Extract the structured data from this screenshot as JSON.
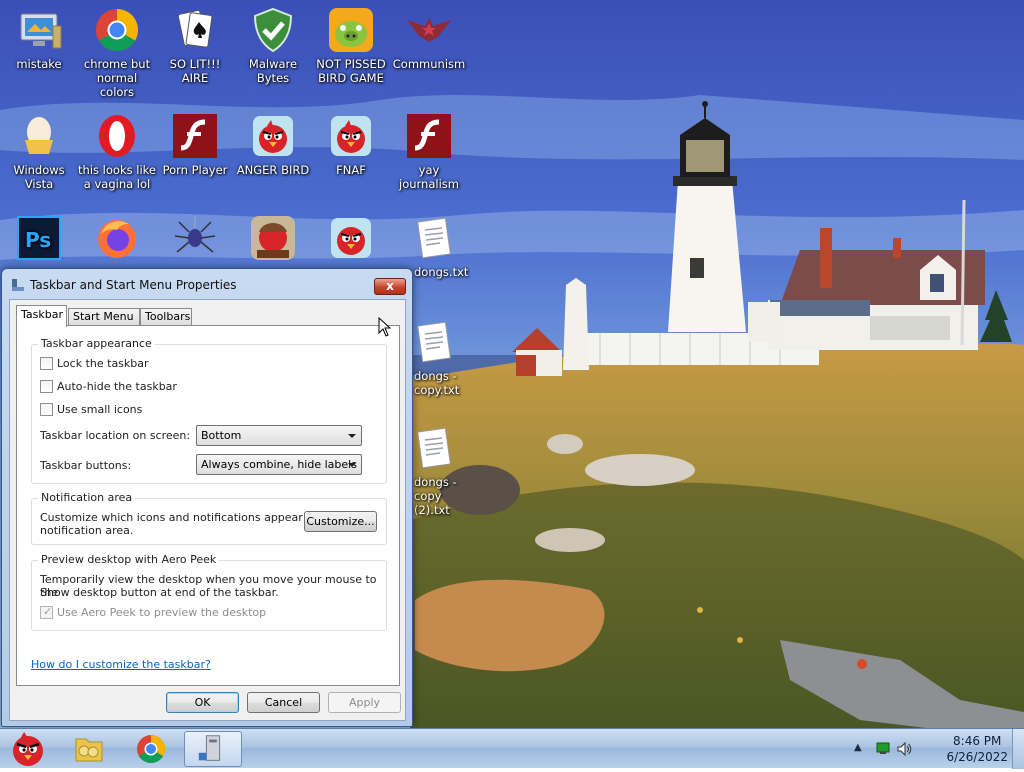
{
  "desktop": {
    "icons": [
      {
        "label": "mistake",
        "icon": "computer-icon"
      },
      {
        "label": "chrome but normal colors",
        "icon": "chrome-icon"
      },
      {
        "label": "SO LIT!!! AIRE",
        "icon": "solitaire-icon"
      },
      {
        "label": "Malware Bytes",
        "icon": "shield-icon"
      },
      {
        "label": "NOT PISSED BIRD GAME",
        "icon": "bad-piggies-icon"
      },
      {
        "label": "Communism",
        "icon": "star-icon"
      },
      {
        "label": "Windows Vista",
        "icon": "egg-icon"
      },
      {
        "label": "this looks like a vagina lol",
        "icon": "opera-icon"
      },
      {
        "label": "Porn Player",
        "icon": "flash-icon"
      },
      {
        "label": "ANGER BIRD",
        "icon": "angry-bird-icon"
      },
      {
        "label": "FNAF",
        "icon": "angry-bird-icon"
      },
      {
        "label": "yay journalism",
        "icon": "flash-icon"
      },
      {
        "label": "",
        "icon": "photoshop-icon"
      },
      {
        "label": "",
        "icon": "firefox-icon"
      },
      {
        "label": "",
        "icon": "spider-solitaire-icon"
      },
      {
        "label": "",
        "icon": "angry-birds-seasons-icon"
      },
      {
        "label": "",
        "icon": "angry-bird-icon"
      },
      {
        "label": "dongs.txt",
        "icon": "text-file-icon"
      },
      {
        "label": "dongs - copy.txt",
        "icon": "text-file-icon"
      },
      {
        "label": "dongs - copy (2).txt",
        "icon": "text-file-icon"
      }
    ]
  },
  "dialog": {
    "title": "Taskbar and Start Menu Properties",
    "close_label": "x",
    "tabs": [
      {
        "label": "Taskbar",
        "selected": true
      },
      {
        "label": "Start Menu",
        "selected": false
      },
      {
        "label": "Toolbars",
        "selected": false
      }
    ],
    "appearance": {
      "title": "Taskbar appearance",
      "lock_label": "Lock the taskbar",
      "autohide_label": "Auto-hide the taskbar",
      "small_icons_label": "Use small icons",
      "location_label": "Taskbar location on screen:",
      "location_value": "Bottom",
      "buttons_label": "Taskbar buttons:",
      "buttons_value": "Always combine, hide labels"
    },
    "notification": {
      "title": "Notification area",
      "description_line1": "Customize which icons and notifications appear in the",
      "description_line2": "notification area.",
      "customize_label": "Customize..."
    },
    "aero_peek": {
      "title": "Preview desktop with Aero Peek",
      "description_line1": "Temporarily view the desktop when you move your mouse to the",
      "description_line2": "Show desktop button at end of the taskbar.",
      "checkbox_label": "Use Aero Peek to preview the desktop"
    },
    "help_link": "How do I customize the taskbar?",
    "ok_label": "OK",
    "cancel_label": "Cancel",
    "apply_label": "Apply"
  },
  "taskbar": {
    "pinned": [
      {
        "icon": "angry-bird-icon"
      },
      {
        "icon": "folder-icon"
      },
      {
        "icon": "chrome-icon"
      },
      {
        "icon": "computer-tower-icon",
        "active": true
      }
    ],
    "time": "8:46 PM",
    "date": "6/26/2022",
    "tray_icons": [
      "arrow-up-icon",
      "network-icon",
      "volume-icon"
    ]
  }
}
